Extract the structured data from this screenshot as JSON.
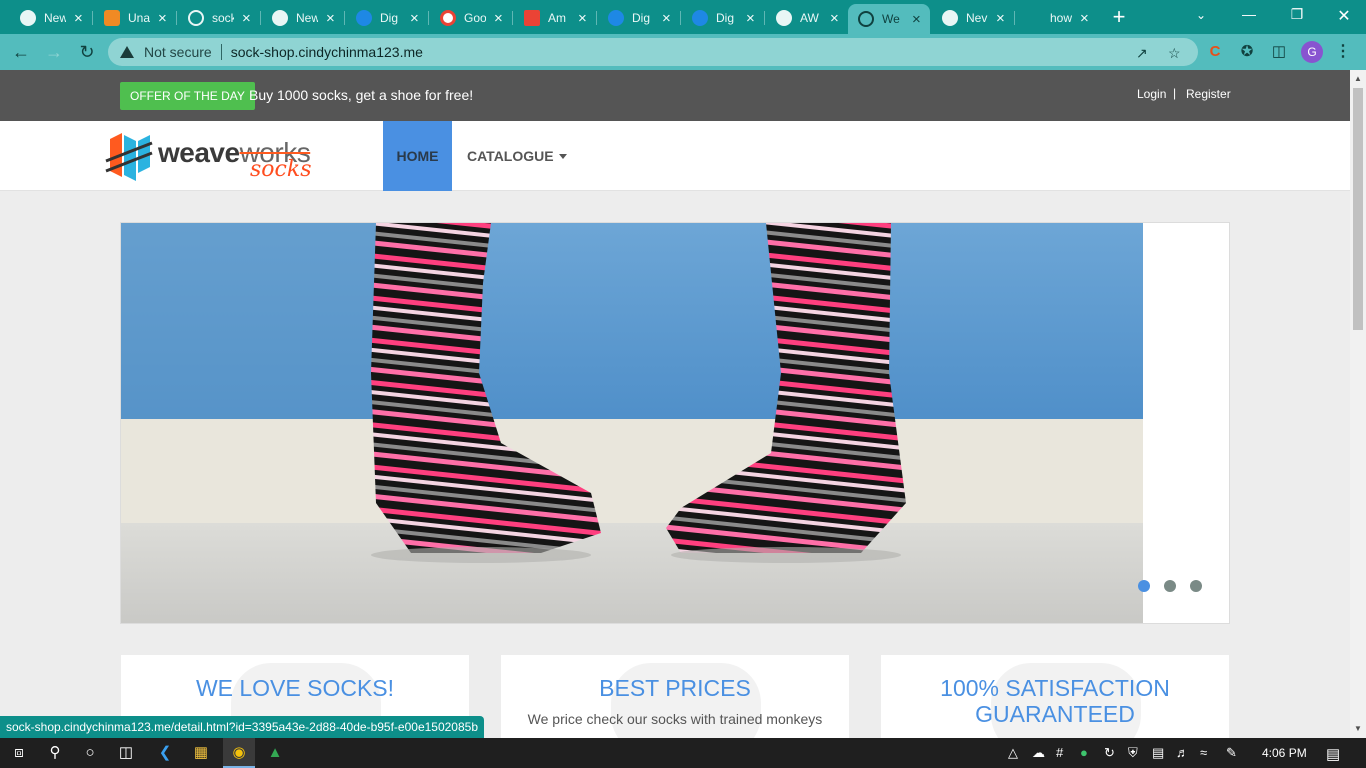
{
  "browser": {
    "tabs": [
      {
        "label": "New",
        "icon": "chrome-icon"
      },
      {
        "label": "Una",
        "icon": "package-icon"
      },
      {
        "label": "sock",
        "icon": "sock-icon"
      },
      {
        "label": "New",
        "icon": "chrome-icon"
      },
      {
        "label": "Dig",
        "icon": "digitalocean-icon"
      },
      {
        "label": "Goo",
        "icon": "google-icon"
      },
      {
        "label": "Am",
        "icon": "gmail-icon"
      },
      {
        "label": "Dig",
        "icon": "digitalocean-icon"
      },
      {
        "label": "Dig",
        "icon": "digitalocean-icon"
      },
      {
        "label": "AW",
        "icon": "chrome-icon"
      },
      {
        "label": "We",
        "icon": "sock-icon",
        "active": true
      },
      {
        "label": "Nev",
        "icon": "chrome-icon"
      },
      {
        "label": "how",
        "icon": "loading-icon"
      }
    ],
    "new_tab": "+",
    "security_label": "Not secure",
    "url": "sock-shop.cindychinma123.me",
    "profile_initial": "G",
    "status_url": "sock-shop.cindychinma123.me/detail.html?id=3395a43e-2d88-40de-b95f-e00e1502085b"
  },
  "site": {
    "offer_badge": "OFFER OF THE DAY",
    "offer_text": "Buy 1000 socks, get a shoe for free!",
    "login": "Login",
    "separator": "|",
    "register": "Register",
    "logo_word": "weave",
    "logo_works": "works",
    "logo_socks": "socks",
    "nav": {
      "home": "HOME",
      "catalogue": "CATALOGUE"
    },
    "carousel": {
      "slides": 3,
      "active_index": 0
    },
    "features": [
      {
        "title": "WE LOVE SOCKS!",
        "text": ""
      },
      {
        "title": "BEST PRICES",
        "text": "We price check our socks with trained monkeys"
      },
      {
        "title": "100% SATISFACTION GUARANTEED",
        "text": ""
      }
    ]
  },
  "taskbar": {
    "clock": "4:06 PM"
  },
  "colors": {
    "tabbar": "#0d8f8a",
    "toolbar": "#53bcbd",
    "offer_green": "#4fbf4f",
    "brand_blue": "#4a90e2",
    "logo_orange": "#ff4d1f"
  }
}
